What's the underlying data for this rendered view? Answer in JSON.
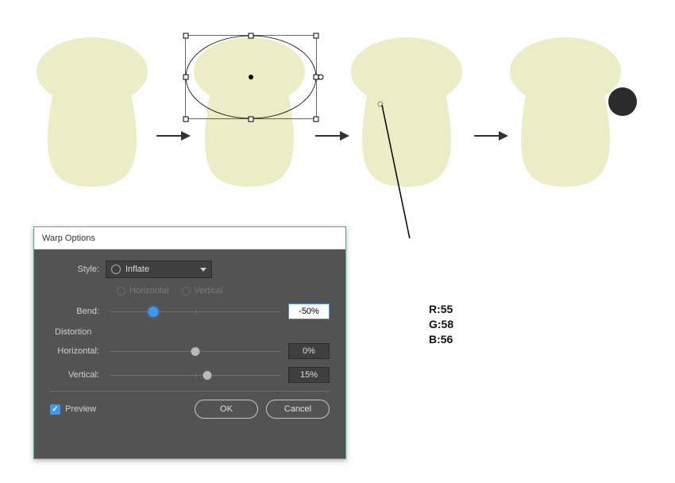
{
  "shapes": {
    "fill_body": "#ecedc7",
    "fill_cap_shadow": "#e1e3b9",
    "ear_fill": "#2b2b2b"
  },
  "dialog": {
    "title": "Warp Options",
    "style_label": "Style:",
    "style_value": "Inflate",
    "axis_horizontal": "Horizontal",
    "axis_vertical": "Vertical",
    "bend_label": "Bend:",
    "bend_value": "-50%",
    "distortion_label": "Distortion",
    "dist_h_label": "Horizontal:",
    "dist_h_value": "0%",
    "dist_v_label": "Vertical:",
    "dist_v_value": "15%",
    "preview_label": "Preview",
    "ok_label": "OK",
    "cancel_label": "Cancel"
  },
  "rgb": {
    "r_label": "R:55",
    "g_label": "G:58",
    "b_label": "B:56"
  }
}
